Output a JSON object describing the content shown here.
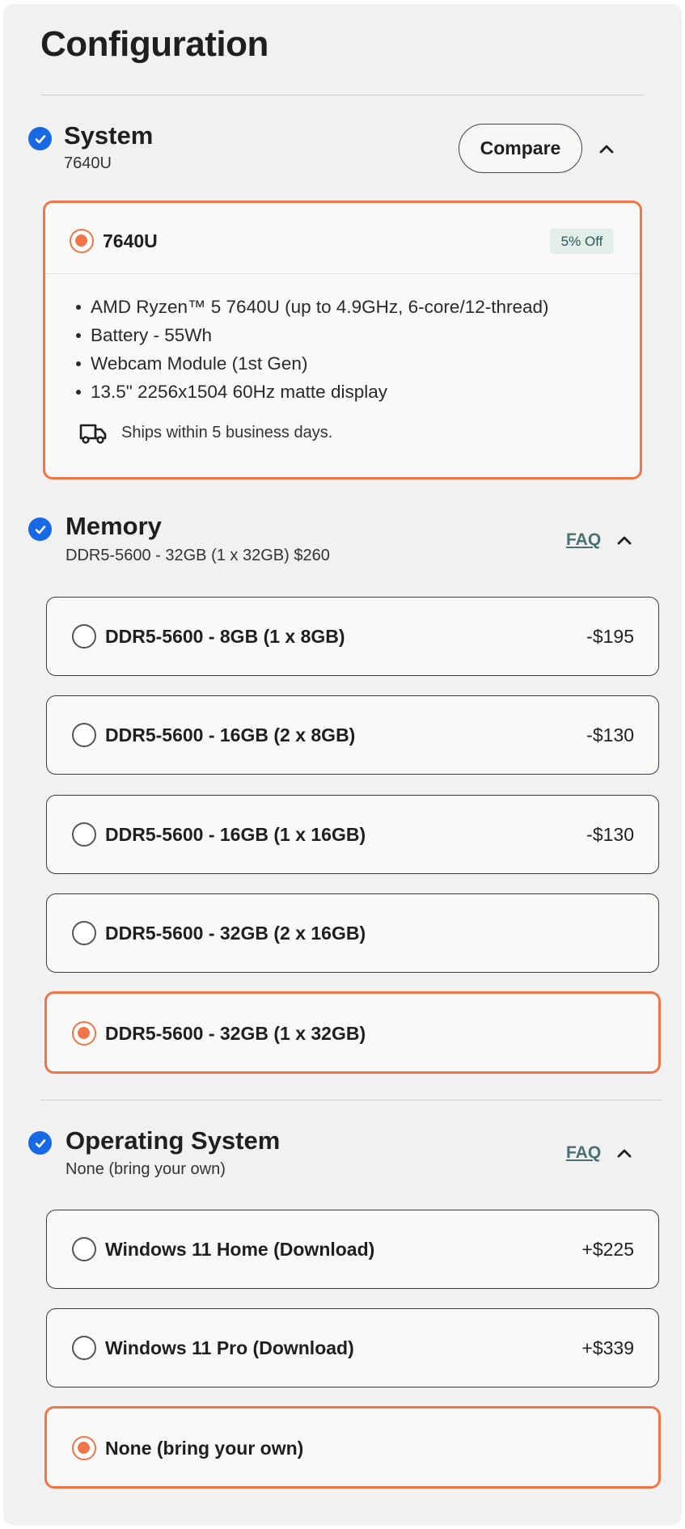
{
  "page_title": "Configuration",
  "colors": {
    "accent": "#f07548",
    "check": "#1769e6",
    "faq": "#4a7070",
    "badge_bg": "#e2eeea"
  },
  "system": {
    "title": "System",
    "subtitle": "7640U",
    "compare_label": "Compare",
    "option": {
      "label": "7640U",
      "badge": "5% Off",
      "features": [
        "AMD Ryzen™ 5 7640U (up to 4.9GHz, 6-core/12-thread)",
        "Battery - 55Wh",
        "Webcam Module (1st Gen)",
        "13.5\" 2256x1504 60Hz matte display"
      ],
      "shipping": "Ships within 5 business days."
    }
  },
  "memory": {
    "title": "Memory",
    "subtitle": "DDR5-5600 - 32GB (1 x 32GB)  $260",
    "faq_label": "FAQ",
    "options": [
      {
        "label": "DDR5-5600 - 8GB (1 x 8GB)",
        "price": "-$195",
        "selected": false
      },
      {
        "label": "DDR5-5600 - 16GB (2 x 8GB)",
        "price": "-$130",
        "selected": false
      },
      {
        "label": "DDR5-5600 - 16GB (1 x 16GB)",
        "price": "-$130",
        "selected": false
      },
      {
        "label": "DDR5-5600 - 32GB (2 x 16GB)",
        "price": "",
        "selected": false
      },
      {
        "label": "DDR5-5600 - 32GB (1 x 32GB)",
        "price": "",
        "selected": true
      }
    ]
  },
  "os": {
    "title": "Operating System",
    "subtitle": "None (bring your own)",
    "faq_label": "FAQ",
    "options": [
      {
        "label": "Windows 11 Home (Download)",
        "price": "+$225",
        "selected": false
      },
      {
        "label": "Windows 11 Pro (Download)",
        "price": "+$339",
        "selected": false
      },
      {
        "label": "None (bring your own)",
        "price": "",
        "selected": true
      }
    ]
  }
}
